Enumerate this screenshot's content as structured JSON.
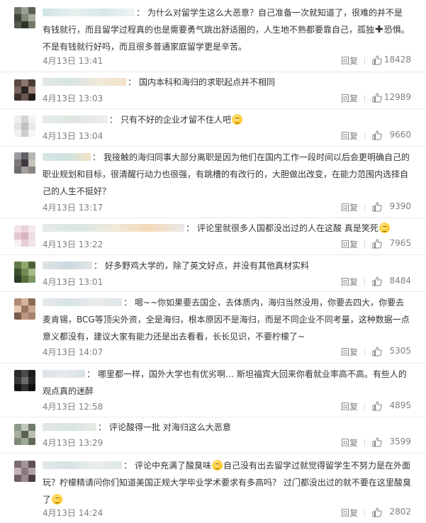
{
  "comments": [
    {
      "text": "为什么对留学生这么大恶意？自己准备一次就知道了，很难的并不是有钱就行，而且留学过程真的也是需要勇气跳出舒适圈的，人生地不熟都要靠自己，孤独",
      "text_after_icon": "恐惧。不是有钱就行好吗，而且很多普通家庭留学更是辛苦。",
      "date": "4月13日 13:41",
      "reply_label": "回复",
      "likes": "18428"
    },
    {
      "text": "国内本科和海归的求职起点并不相同",
      "date": "4月13日 13:03",
      "reply_label": "回复",
      "likes": "12989"
    },
    {
      "text": "只有不好的企业才留不住人吧",
      "date": "4月13日 13:04",
      "reply_label": "回复",
      "likes": "9660"
    },
    {
      "text": "我接触的海归同事大部分离职是因为他们在国内工作一段时间以后会更明确自己的职业规划和目标，很清醒行动力也很强，有跳槽的有改行的，大胆做出改变，在能力范围内选择自己的人生不挺好？",
      "date": "4月13日 13:17",
      "reply_label": "回复",
      "likes": "9390"
    },
    {
      "text": "评论里就很多人国都没出过的人在这酸 真是笑死",
      "date": "4月13日 13:22",
      "reply_label": "回复",
      "likes": "7965"
    },
    {
      "text": "好多野鸡大学的，除了英文好点，并没有其他真材实料",
      "date": "4月13日 13:01",
      "reply_label": "回复",
      "likes": "8484"
    },
    {
      "text": "嗯~~你如果要去国企，去体质内，海归当然没用，你要去四大，你要去麦肯锡，BCG等顶尖外资，全是海归，根本原因不是海归，而是不同企业不同考量，这种数据一点意义都没有，建议大家有能力还是出去看看，长长见识，不要柠檬了~",
      "date": "4月13日 14:07",
      "reply_label": "回复",
      "likes": "5305"
    },
    {
      "text": "哪里都一样，国外大学也有优劣啊… 斯坦福宾大回来你看就业率高不高。有些人的观点真的迷醉",
      "date": "4月13日 12:58",
      "reply_label": "回复",
      "likes": "4895"
    },
    {
      "text": "评论酸得一批 对海归这么大恶意",
      "date": "4月13日 13:29",
      "reply_label": "回复",
      "likes": "3599"
    },
    {
      "text": "评论中充满了酸臭味",
      "text_after_emoji": "自己没有出去留学过就觉得留学生不努力是在外面玩？柠檬精请问你们知道美国正规大学毕业学术要求有多高吗？ 过门都没出过的就不要在这里酸臭了",
      "date": "4月13日 14:24",
      "reply_label": "回复",
      "likes": "2802"
    }
  ],
  "colors": {
    "text": "#333333",
    "meta": "#808080",
    "divider": "#eaeaea"
  }
}
